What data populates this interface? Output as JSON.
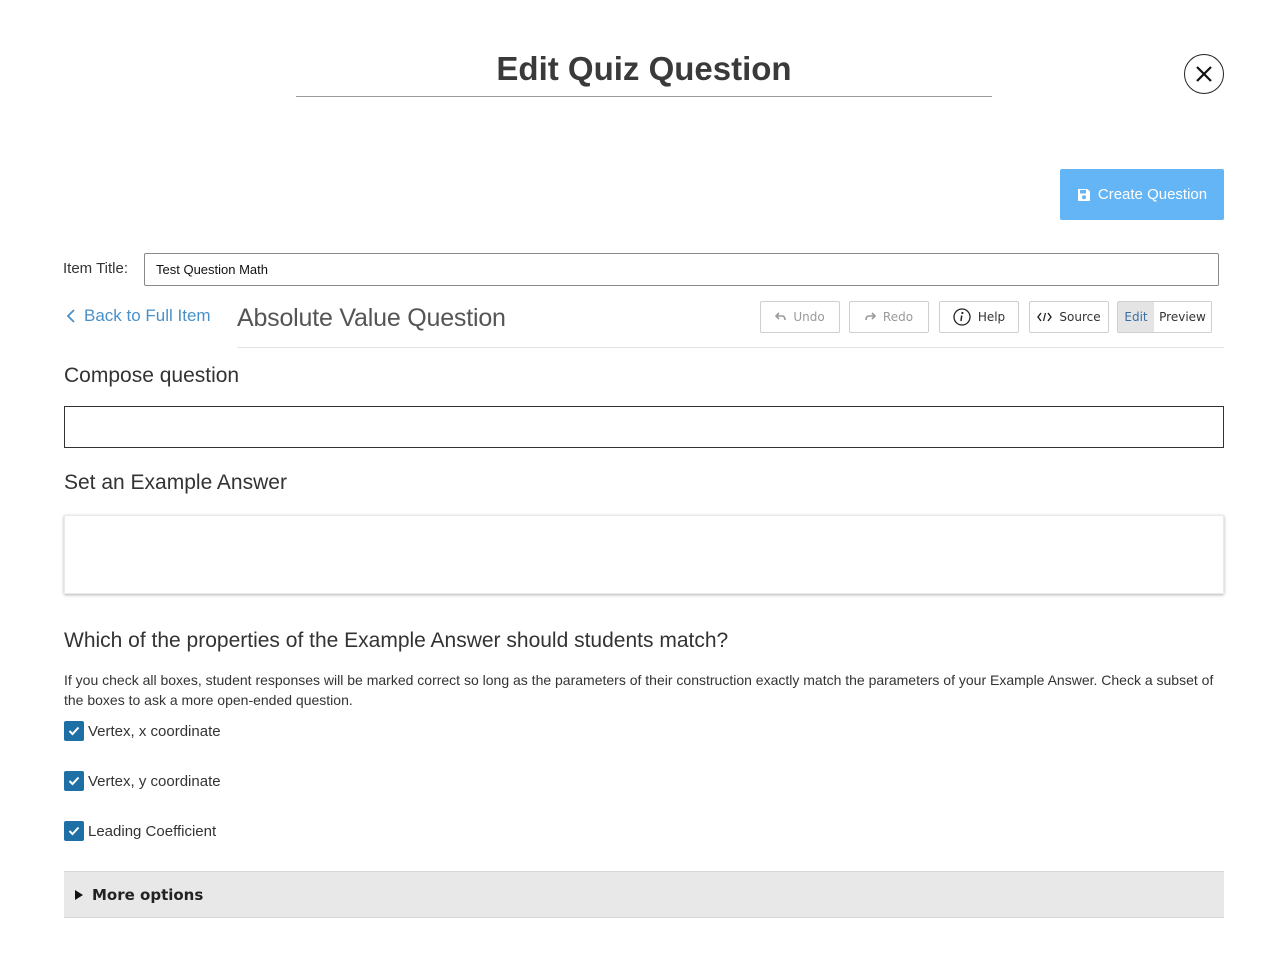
{
  "modal": {
    "title": "Edit Quiz Question",
    "close_icon": "close-icon"
  },
  "toolbar": {
    "create_label": "Create Question",
    "create_icon": "save-icon",
    "accent": "#64b5f6"
  },
  "item_title": {
    "label": "Item Title:",
    "value": "Test Question Math"
  },
  "subheader": {
    "back_label": "Back to Full Item",
    "question_type": "Absolute Value Question",
    "undo_label": "Undo",
    "redo_label": "Redo",
    "help_label": "Help",
    "source_label": "Source",
    "edit_label": "Edit",
    "preview_label": "Preview",
    "link_color": "#4a90c8"
  },
  "compose": {
    "heading": "Compose question",
    "value": ""
  },
  "example": {
    "heading": "Set an Example Answer"
  },
  "match": {
    "heading": "Which of the properties of the Example Answer should students match?",
    "help_text": "If you check all boxes, student responses will be marked correct so long as the parameters of their construction exactly match the parameters of your Example Answer. Check a subset of the boxes to ask a more open-ended question.",
    "options": [
      {
        "label": "Vertex, x coordinate",
        "checked": true
      },
      {
        "label": "Vertex, y coordinate",
        "checked": true
      },
      {
        "label": "Leading Coefficient",
        "checked": true
      }
    ],
    "checkbox_color": "#1d6fa5"
  },
  "more_options": {
    "label": "More options"
  }
}
